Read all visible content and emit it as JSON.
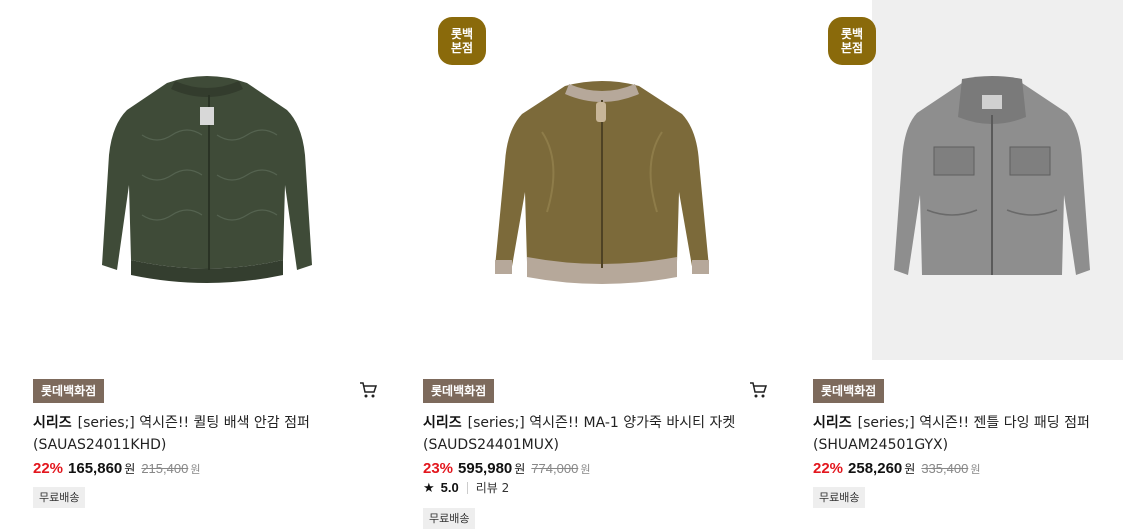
{
  "products": [
    {
      "store_badge": "롯데백화점",
      "brand": "시리즈",
      "name": "[series;] 역시즌!! 퀼팅 배색 안감 점퍼 (SAUAS24011KHD)",
      "discount": "22%",
      "price": "165,860",
      "currency": "원",
      "original_price": "215,400",
      "shipping": "무료배송",
      "image_icon": "khaki-quilted-jacket-image"
    },
    {
      "top_badge_line1": "롯백",
      "top_badge_line2": "본점",
      "store_badge": "롯데백화점",
      "brand": "시리즈",
      "name": "[series;] 역시즌!! MA-1 양가죽 바시티 자켓 (SAUDS24401MUX)",
      "discount": "23%",
      "price": "595,980",
      "currency": "원",
      "original_price": "774,000",
      "rating": "5.0",
      "review_label": "리뷰 2",
      "shipping": "무료배송",
      "image_icon": "leather-varsity-jacket-image"
    },
    {
      "top_badge_line1": "롯백",
      "top_badge_line2": "본점",
      "store_badge": "롯데백화점",
      "brand": "시리즈",
      "name": "[series;] 역시즌!! 젠틀 다잉 패딩 점퍼 (SHUAM24501GYX)",
      "discount": "22%",
      "price": "258,260",
      "currency": "원",
      "original_price": "335,400",
      "shipping": "무료배송",
      "image_icon": "grey-field-jacket-image"
    }
  ],
  "colors": {
    "discount": "#e3171e",
    "store_tag": "#7d6a5c",
    "top_badge": "#8a6a0b"
  }
}
